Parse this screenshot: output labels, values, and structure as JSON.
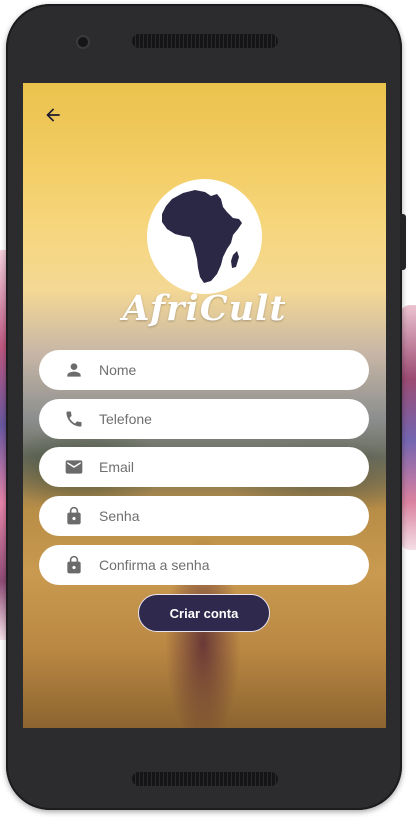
{
  "app": {
    "brand_name": "AfriCult",
    "accent_color": "#2f2a4d"
  },
  "navigation": {
    "back_icon": "arrow-left-icon"
  },
  "form": {
    "fields": [
      {
        "icon": "person-icon",
        "placeholder": "Nome",
        "value": ""
      },
      {
        "icon": "phone-icon",
        "placeholder": "Telefone",
        "value": ""
      },
      {
        "icon": "email-icon",
        "placeholder": "Email",
        "value": ""
      },
      {
        "icon": "lock-icon",
        "placeholder": "Senha",
        "value": ""
      },
      {
        "icon": "lock-icon",
        "placeholder": "Confirma a senha",
        "value": ""
      }
    ],
    "submit_label": "Criar conta"
  }
}
